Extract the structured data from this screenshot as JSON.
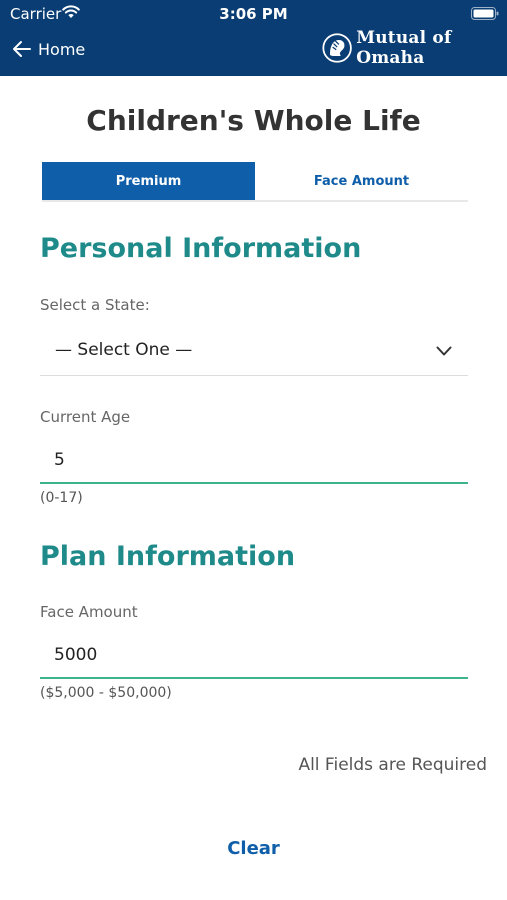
{
  "status_bar": {
    "carrier": "Carrier",
    "time": "3:06 PM"
  },
  "nav": {
    "back_label": "Home",
    "brand_text": "Mutual of Omaha",
    "back_icon": "arrow-left-icon",
    "brand_icon": "lion-logo-icon"
  },
  "page": {
    "title": "Children's Whole Life"
  },
  "tabs": [
    {
      "label": "Premium",
      "active": true
    },
    {
      "label": "Face Amount",
      "active": false
    }
  ],
  "personal": {
    "heading": "Personal Information",
    "state_label": "Select a State:",
    "state_value": "— Select One —",
    "age_label": "Current Age",
    "age_value": "5",
    "age_hint": "(0-17)"
  },
  "plan": {
    "heading": "Plan Information",
    "face_label": "Face Amount",
    "face_value": "5000",
    "face_hint": "($5,000 - $50,000)"
  },
  "footer": {
    "required_note": "All Fields are Required",
    "clear_label": "Clear"
  },
  "colors": {
    "header_bg": "#0a3d73",
    "accent_blue": "#0f5ea9",
    "heading_teal": "#1f8a8a",
    "field_underline": "#3db389"
  }
}
